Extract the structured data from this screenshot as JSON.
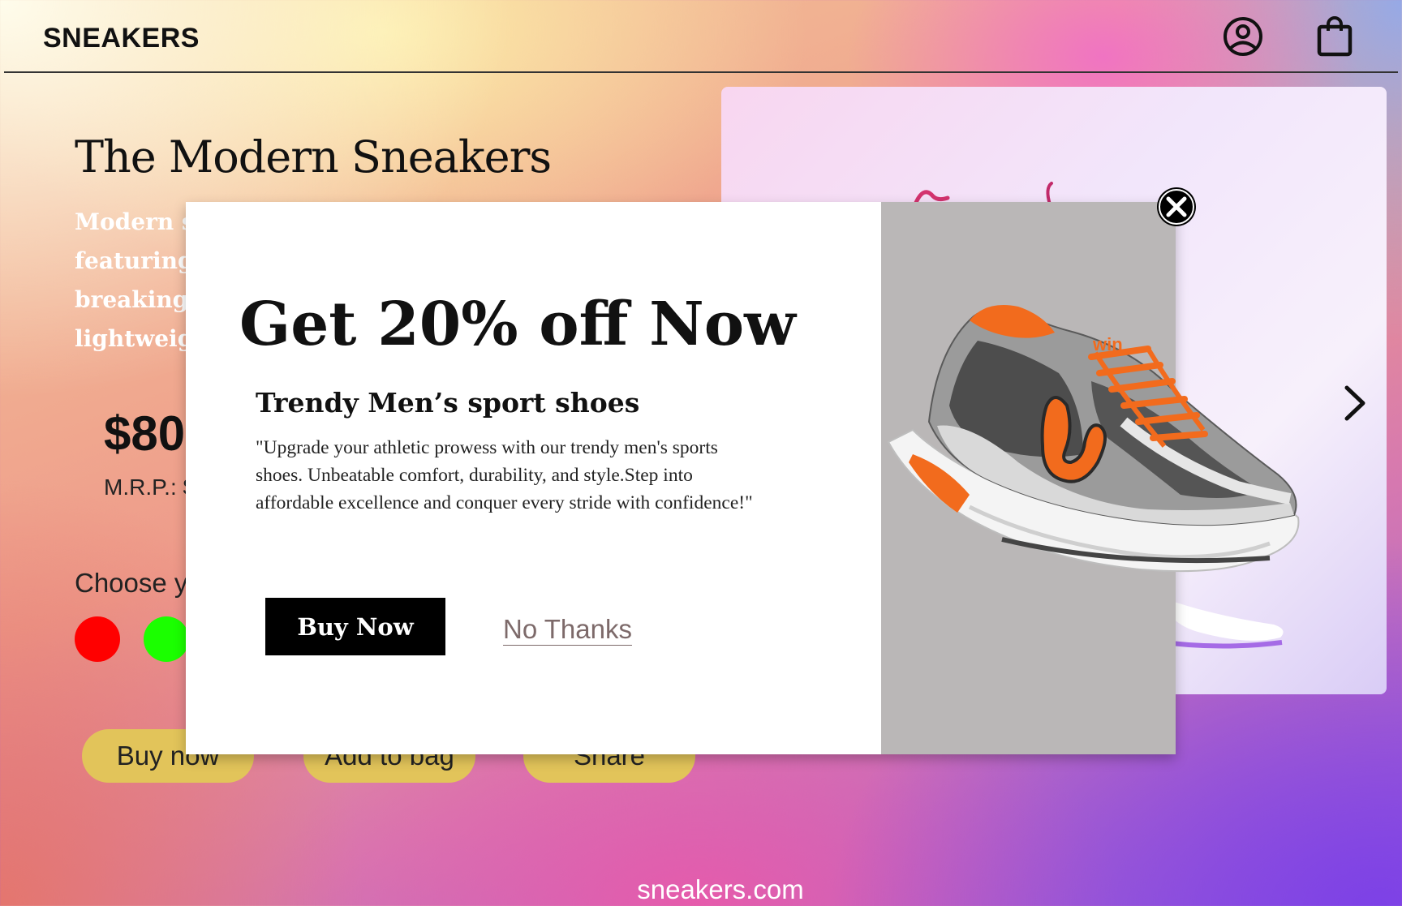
{
  "header": {
    "logo": "SNEAKERS",
    "icons": [
      "profile-icon",
      "shopping-bag-icon"
    ]
  },
  "product": {
    "title": "The Modern Sneakers",
    "description_visible": [
      "Modern sne",
      "featuring i",
      "breaking th",
      "lightweigh"
    ],
    "price": "$80",
    "mrp_label": "M.R.P.: $",
    "choose_label": "Choose y",
    "swatches": [
      "#ff0000",
      "#1bff00"
    ],
    "buttons": [
      "Buy now",
      "Add to bag",
      "Share"
    ]
  },
  "footer": {
    "site": "sneakers.com"
  },
  "modal": {
    "headline": "Get 20% off Now",
    "subtitle": "Trendy Men’s sport shoes",
    "body": "\"Upgrade your athletic prowess with our trendy men's sports shoes. Unbeatable comfort, durability, and style.Step into affordable excellence and conquer every stride with confidence!\"",
    "buy_label": "Buy Now",
    "decline_label": "No Thanks",
    "shoe_brand": "win"
  },
  "colors": {
    "pill_bg": "#e2c45a",
    "modal_right_bg": "#bab7b7",
    "shoe_accent": "#f26b1d",
    "decline_text": "#7d6a6a"
  }
}
